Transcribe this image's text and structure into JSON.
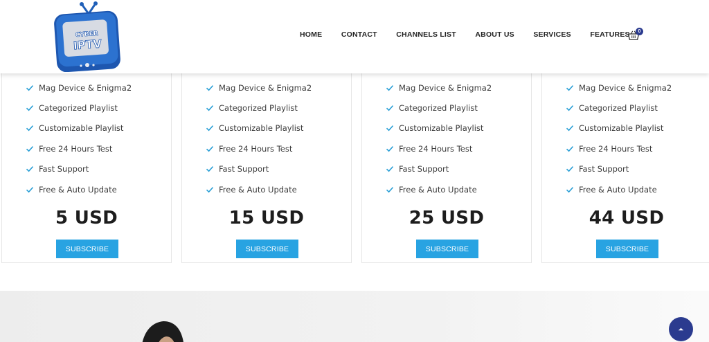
{
  "header": {
    "logo_text_top": "CYBER",
    "logo_text_bottom": "IPTV",
    "nav": [
      {
        "label": "HOME"
      },
      {
        "label": "CONTACT"
      },
      {
        "label": "CHANNELS LIST"
      },
      {
        "label": "ABOUT US"
      },
      {
        "label": "SERVICES"
      },
      {
        "label": "FEATURES"
      }
    ],
    "cart": {
      "icon": "cart-icon",
      "count": "0"
    }
  },
  "plans": [
    {
      "features": [
        "Mag Device & Enigma2",
        "Categorized Playlist",
        "Customizable Playlist",
        "Free 24 Hours Test",
        "Fast Support",
        "Free & Auto Update"
      ],
      "price": "5 USD",
      "button": "SUBSCRIBE"
    },
    {
      "features": [
        "Mag Device & Enigma2",
        "Categorized Playlist",
        "Customizable Playlist",
        "Free 24 Hours Test",
        "Fast Support",
        "Free & Auto Update"
      ],
      "price": "15 USD",
      "button": "SUBSCRIBE"
    },
    {
      "features": [
        "Mag Device & Enigma2",
        "Categorized Playlist",
        "Customizable Playlist",
        "Free 24 Hours Test",
        "Fast Support",
        "Free & Auto Update"
      ],
      "price": "25 USD",
      "button": "SUBSCRIBE"
    },
    {
      "features": [
        "Mag Device & Enigma2",
        "Categorized Playlist",
        "Customizable Playlist",
        "Free 24 Hours Test",
        "Fast Support",
        "Free & Auto Update"
      ],
      "price": "44 USD",
      "button": "SUBSCRIBE"
    }
  ],
  "colors": {
    "accent": "#28a3e2",
    "brand": "#2b3b8f",
    "check": "#2a9fd6"
  },
  "scroll_top": {
    "icon": "chevron-up-icon"
  }
}
